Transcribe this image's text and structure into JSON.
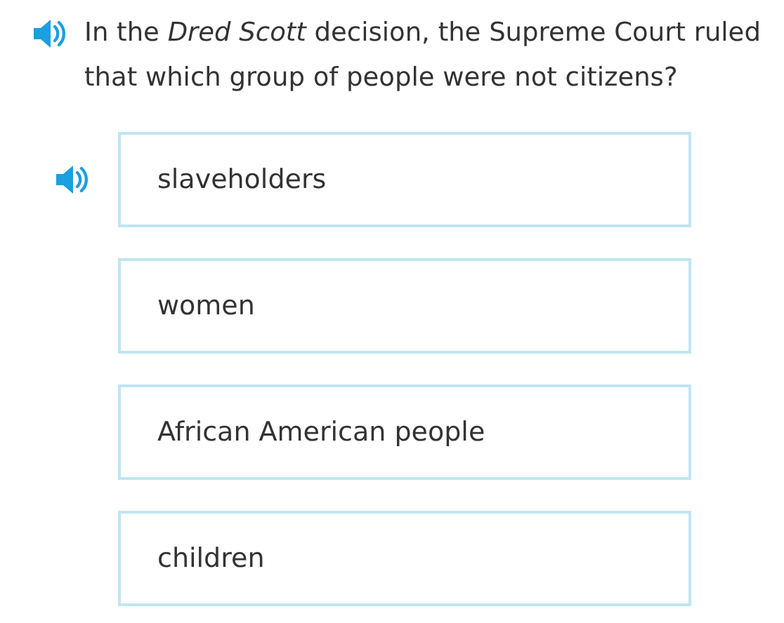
{
  "question": {
    "audio": true,
    "text": "In the *Dred Scott* decision, the Supreme Court ruled that which group of people were not citizens?"
  },
  "options": [
    {
      "label": "slaveholders",
      "audio": true
    },
    {
      "label": "women",
      "audio": false
    },
    {
      "label": "African American people",
      "audio": false
    },
    {
      "label": "children",
      "audio": false
    }
  ]
}
